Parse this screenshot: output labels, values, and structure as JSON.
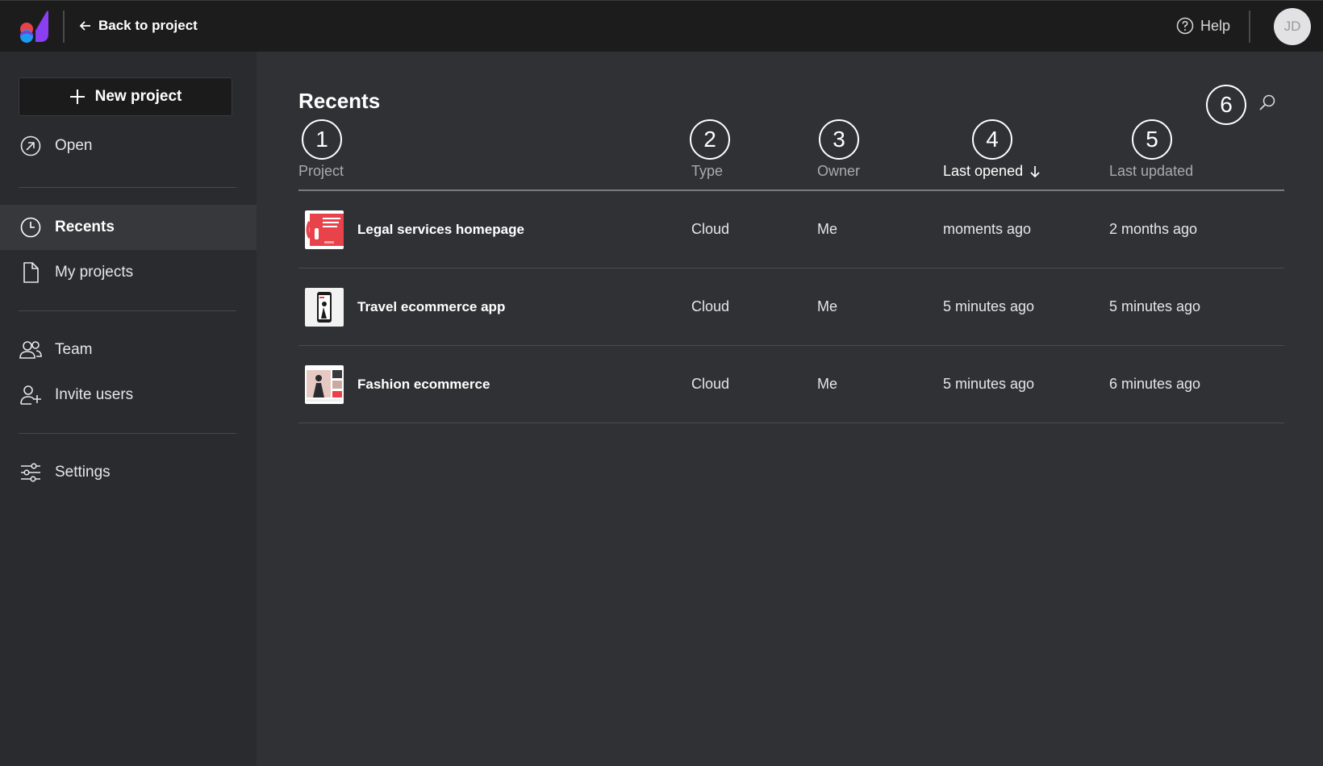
{
  "header": {
    "back_label": "Back to project",
    "help_label": "Help",
    "avatar_initials": "JD"
  },
  "sidebar": {
    "new_project_label": "New project",
    "items": [
      {
        "label": "Open",
        "icon": "open-arrow-icon"
      },
      {
        "label": "Recents",
        "icon": "clock-icon",
        "active": true
      },
      {
        "label": "My projects",
        "icon": "file-icon"
      },
      {
        "label": "Team",
        "icon": "team-icon"
      },
      {
        "label": "Invite users",
        "icon": "user-plus-icon"
      },
      {
        "label": "Settings",
        "icon": "sliders-icon"
      }
    ]
  },
  "main": {
    "title": "Recents",
    "search_icon": "search-icon",
    "badges": [
      "1",
      "2",
      "3",
      "4",
      "5",
      "6"
    ],
    "columns": {
      "project": "Project",
      "type": "Type",
      "owner": "Owner",
      "last_opened": "Last opened",
      "last_updated": "Last updated"
    },
    "rows": [
      {
        "name": "Legal services homepage",
        "type": "Cloud",
        "owner": "Me",
        "last_opened": "moments ago",
        "last_updated": "2 months ago"
      },
      {
        "name": "Travel ecommerce app",
        "type": "Cloud",
        "owner": "Me",
        "last_opened": "5 minutes ago",
        "last_updated": "5 minutes ago"
      },
      {
        "name": "Fashion ecommerce",
        "type": "Cloud",
        "owner": "Me",
        "last_opened": "5 minutes ago",
        "last_updated": "6 minutes ago"
      }
    ]
  },
  "colors": {
    "topbar": "#1c1c1d",
    "sidebar": "#2a2b2e",
    "main": "#303134",
    "accent_red": "#e8434b",
    "logo_purple": "#8a3ff2",
    "logo_blue": "#1d9bf0"
  }
}
